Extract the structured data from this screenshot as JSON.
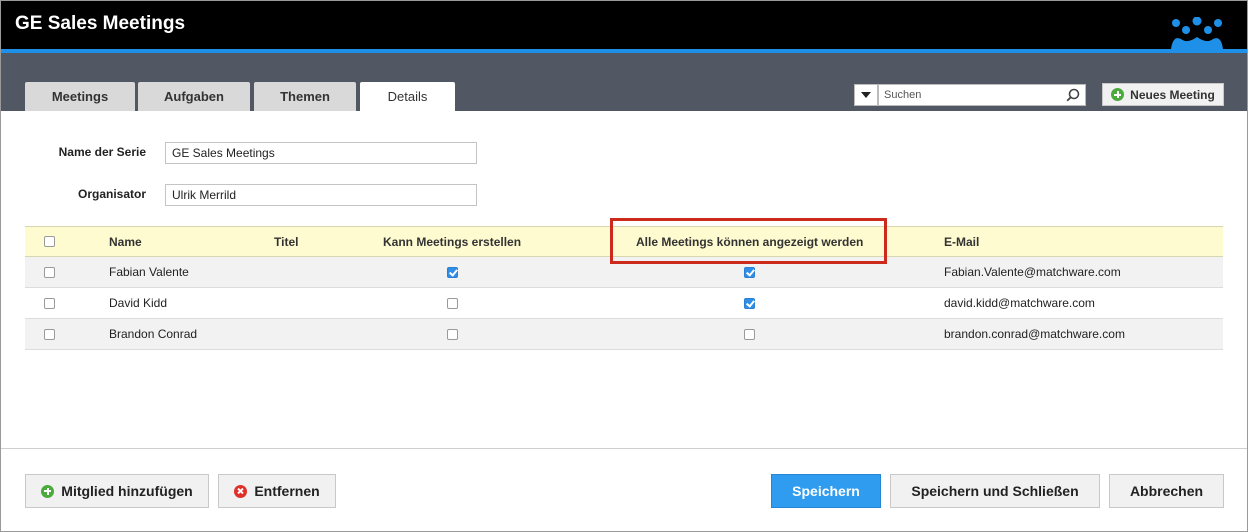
{
  "app": {
    "title": "GE Sales Meetings"
  },
  "tabs": [
    {
      "label": "Meetings",
      "active": false
    },
    {
      "label": "Aufgaben",
      "active": false
    },
    {
      "label": "Themen",
      "active": false
    },
    {
      "label": "Details",
      "active": true
    }
  ],
  "search": {
    "placeholder": "Suchen",
    "value": ""
  },
  "toolbar": {
    "new_meeting_label": "Neues Meeting"
  },
  "form": {
    "series_label": "Name der Serie",
    "series_value": "GE Sales Meetings",
    "organizer_label": "Organisator",
    "organizer_value": "Ulrik Merrild"
  },
  "table": {
    "headers": {
      "name": "Name",
      "title": "Titel",
      "can_create": "Kann Meetings erstellen",
      "can_view_all": "Alle Meetings können angezeigt werden",
      "email": "E-Mail"
    },
    "rows": [
      {
        "selected": false,
        "name": "Fabian Valente",
        "title": "",
        "can_create": true,
        "can_view_all": true,
        "email": "Fabian.Valente@matchware.com"
      },
      {
        "selected": false,
        "name": "David Kidd",
        "title": "",
        "can_create": false,
        "can_view_all": true,
        "email": "david.kidd@matchware.com"
      },
      {
        "selected": false,
        "name": "Brandon Conrad",
        "title": "",
        "can_create": false,
        "can_view_all": false,
        "email": "brandon.conrad@matchware.com"
      }
    ]
  },
  "footer": {
    "add_member_label": "Mitglied hinzufügen",
    "remove_label": "Entfernen",
    "save_label": "Speichern",
    "save_close_label": "Speichern und Schließen",
    "cancel_label": "Abbrechen"
  },
  "colors": {
    "accent": "#1e90e8",
    "primary_button": "#2f9cf0",
    "header_row": "#fdfbcf",
    "highlight_border": "#cc2a1a"
  }
}
